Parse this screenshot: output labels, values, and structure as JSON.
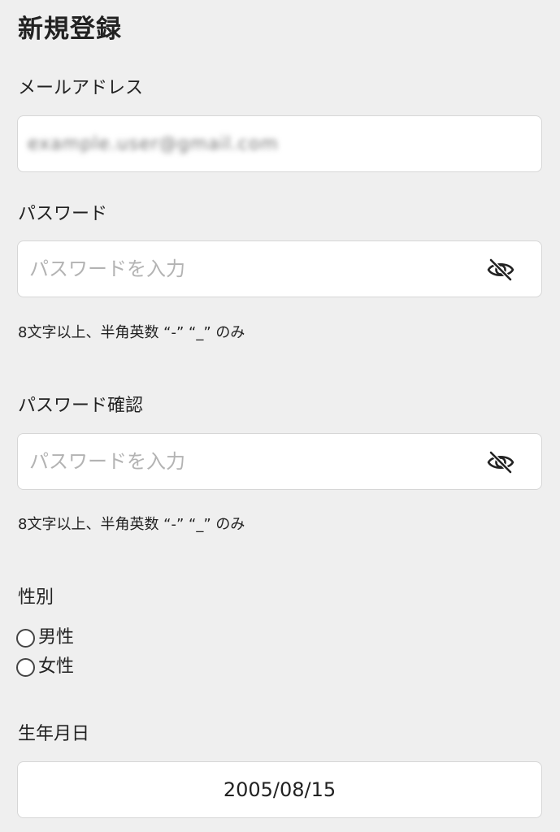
{
  "page": {
    "title": "新規登録"
  },
  "email": {
    "label": "メールアドレス",
    "value": "example.user@gmail.com"
  },
  "password": {
    "label": "パスワード",
    "placeholder": "パスワードを入力",
    "hint": "8文字以上、半角英数 “-” “_” のみ",
    "toggle_icon": "eye-off-icon"
  },
  "password_confirm": {
    "label": "パスワード確認",
    "placeholder": "パスワードを入力",
    "hint": "8文字以上、半角英数 “-” “_” のみ",
    "toggle_icon": "eye-off-icon"
  },
  "gender": {
    "label": "性別",
    "options": [
      {
        "label": "男性",
        "selected": false
      },
      {
        "label": "女性",
        "selected": false
      }
    ]
  },
  "birthday": {
    "label": "生年月日",
    "value": "2005/08/15"
  }
}
